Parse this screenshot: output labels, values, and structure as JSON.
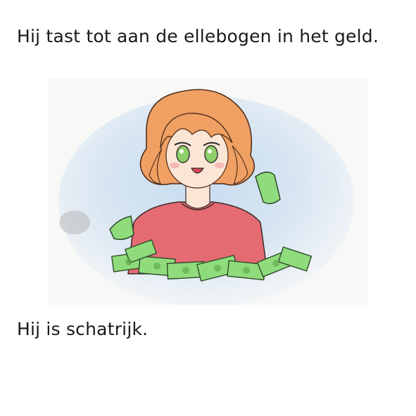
{
  "captions": {
    "top": "Hij tast tot aan de ellebogen in het geld.",
    "bottom": "Hij is schatrijk."
  },
  "illustration": {
    "icon": "person-in-money-drawing",
    "colors": {
      "hair": "#f0a062",
      "shirt": "#e56b72",
      "skin": "#fbe6d6",
      "eyes": "#8fcf6a",
      "money": "#8fdc7c",
      "background": "#c8dcef"
    }
  }
}
